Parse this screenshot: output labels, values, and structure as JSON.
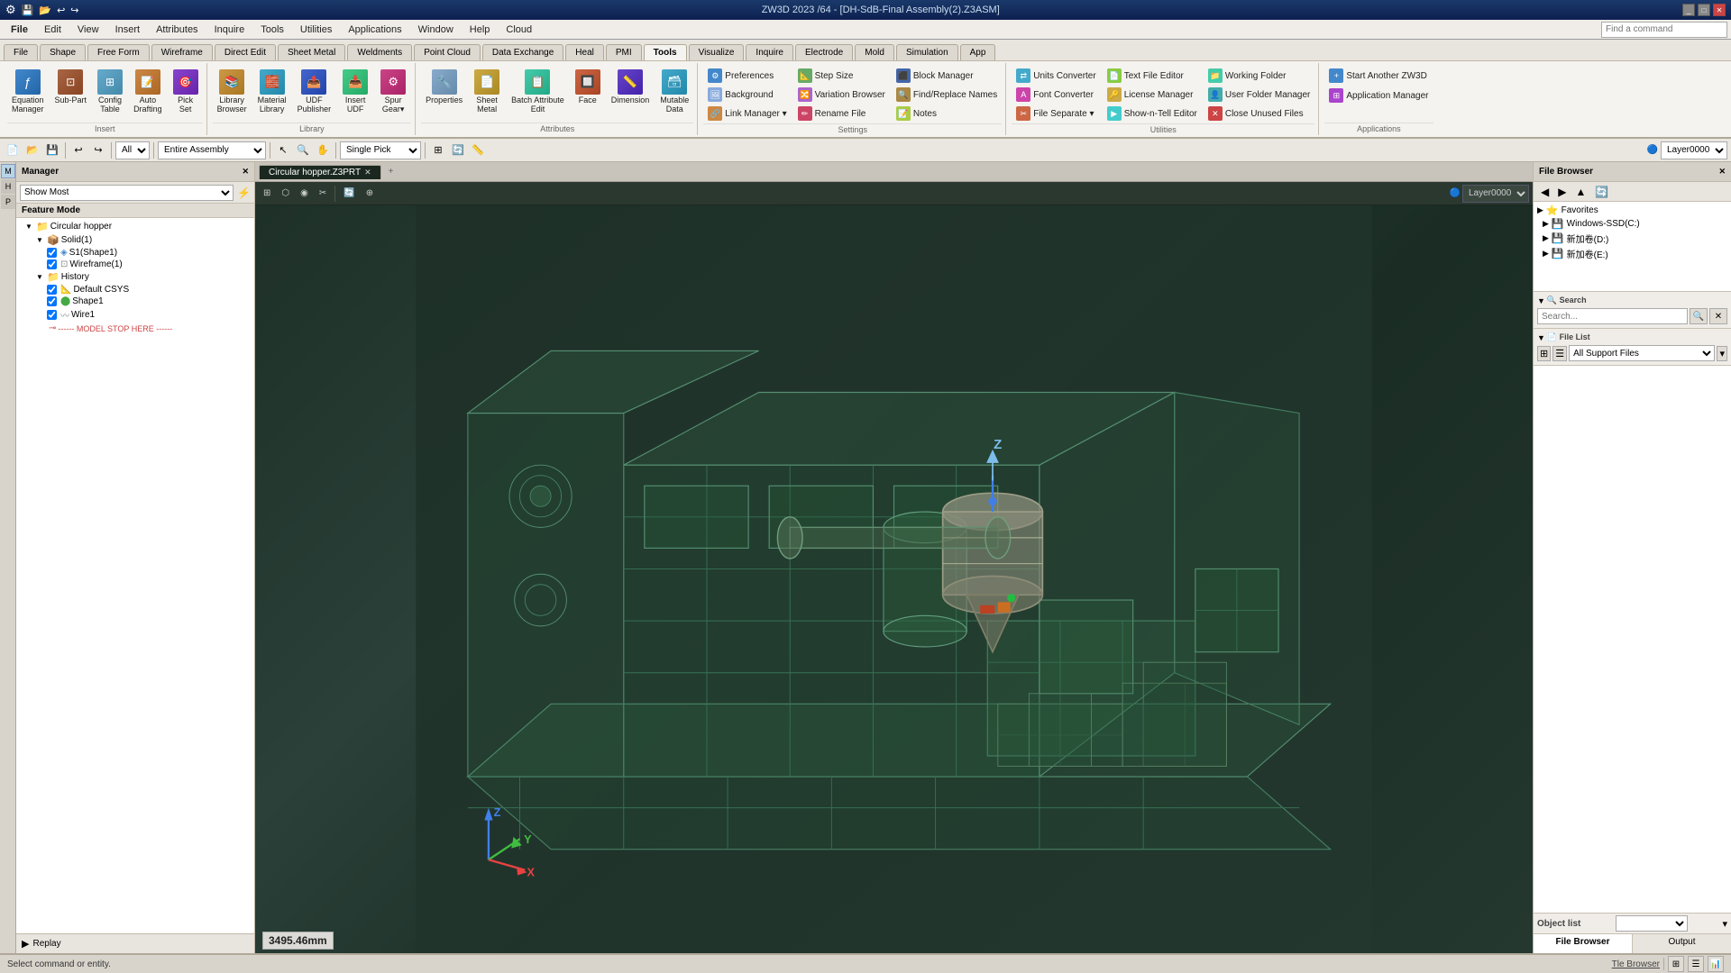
{
  "title_bar": {
    "title": "ZW3D 2023 /64 - [DH-SdB-Final Assembly(2).Z3ASM]",
    "app_icon": "⚙"
  },
  "menu_bar": {
    "items": [
      "File",
      "Edit",
      "View",
      "Insert",
      "Attributes",
      "Inquire",
      "Tools",
      "Utilities",
      "Applications",
      "Window",
      "Help",
      "Cloud"
    ]
  },
  "ribbon": {
    "tabs": [
      "File",
      "Shape",
      "Free Form",
      "Wireframe",
      "Direct Edit",
      "Sheet Metal",
      "Weldments",
      "Point Cloud",
      "Data Exchange",
      "Heal",
      "PMI",
      "Tools",
      "Visualize",
      "Inquire",
      "Electrode",
      "Mold",
      "Simulation",
      "App"
    ],
    "active_tab": "Tools",
    "groups": {
      "equation": {
        "label": "Equation\nManager",
        "group_name": "Insert"
      },
      "sub_part": {
        "label": "Sub-Part",
        "group_name": "Insert"
      },
      "config_table": {
        "label": "Config\nTable",
        "group_name": "Insert"
      },
      "auto_drafting": {
        "label": "Auto\nDrafting",
        "group_name": "Insert"
      },
      "pick_set": {
        "label": "Pick\nSet",
        "group_name": "Insert"
      },
      "library_browser": {
        "label": "Library\nBrowser",
        "group_name": "Library"
      },
      "material_library": {
        "label": "Material\nLibrary",
        "group_name": "Library"
      },
      "udf_publisher": {
        "label": "UDF\nPublisher",
        "group_name": "Library"
      },
      "insert_udf": {
        "label": "Insert\nUDF",
        "group_name": "Library"
      },
      "spur_gear": {
        "label": "Spur\nGear",
        "group_name": "Library"
      },
      "properties": {
        "label": "Properties",
        "group_name": "Attributes"
      },
      "sheet_metal": {
        "label": "Sheet\nMetal",
        "group_name": "Attributes"
      },
      "batch_attribute": {
        "label": "Batch Attribute\nEdit",
        "group_name": "Attributes"
      },
      "face": {
        "label": "Face",
        "group_name": "Attributes"
      },
      "dimension": {
        "label": "Dimension",
        "group_name": "Attributes"
      },
      "mutable_data": {
        "label": "Mutable\nData",
        "group_name": "Attributes"
      },
      "preferences": {
        "label": "Preferences",
        "group_name": "Settings"
      },
      "background": {
        "label": "Background",
        "group_name": "Settings"
      },
      "link_manager": {
        "label": "Link Manager ▾",
        "group_name": "Settings"
      },
      "step_size": {
        "label": "Step Size",
        "group_name": "Settings"
      },
      "variation_browser": {
        "label": "Variation Browser",
        "group_name": "Settings"
      },
      "rename_file": {
        "label": "Rename File",
        "group_name": "Settings"
      },
      "block_manager": {
        "label": "Block Manager",
        "group_name": "Settings"
      },
      "find_replace": {
        "label": "Find/Replace Names",
        "group_name": "Settings"
      },
      "units_converter": {
        "label": "Units Converter",
        "group_name": "Utilities"
      },
      "text_file_editor": {
        "label": "Text File Editor",
        "group_name": "Utilities"
      },
      "working_folder": {
        "label": "Working Folder",
        "group_name": "Utilities"
      },
      "start_another": {
        "label": "Start Another ZW3D",
        "group_name": "Applications"
      },
      "font_converter": {
        "label": "Font Converter",
        "group_name": "Utilities"
      },
      "license_manager": {
        "label": "License Manager",
        "group_name": "Utilities"
      },
      "file_separate": {
        "label": "File Separate ▾",
        "group_name": "Utilities"
      },
      "show_n_tell": {
        "label": "Show-n-Tell Editor",
        "group_name": "Utilities"
      },
      "user_folder": {
        "label": "User Folder Manager",
        "group_name": "Utilities"
      },
      "close_unused": {
        "label": "Close Unused Files",
        "group_name": "Utilities"
      },
      "application_manager": {
        "label": "Application Manager",
        "group_name": "Applications"
      },
      "notes": {
        "label": "Notes",
        "group_name": "Settings"
      }
    }
  },
  "toolbar": {
    "filter_label": "All",
    "scope_label": "Entire Assembly",
    "pick_mode": "Single Pick",
    "layer": "Layer0000"
  },
  "left_panel": {
    "title": "Manager",
    "filter_label": "Show Most",
    "feature_mode_label": "Feature Mode",
    "tree": [
      {
        "level": 0,
        "icon": "📁",
        "label": "Circular hopper",
        "expanded": true
      },
      {
        "level": 1,
        "icon": "📦",
        "label": "Solid(1)",
        "expanded": true
      },
      {
        "level": 2,
        "icon": "🔷",
        "label": "S1(Shape1)",
        "checked": true
      },
      {
        "level": 2,
        "icon": "🔲",
        "label": "Wireframe(1)",
        "checked": true
      },
      {
        "level": 1,
        "icon": "📁",
        "label": "History",
        "expanded": true
      },
      {
        "level": 2,
        "icon": "📐",
        "label": "Default CSYS",
        "checked": true
      },
      {
        "level": 2,
        "icon": "🟢",
        "label": "Shape1",
        "checked": true
      },
      {
        "level": 2,
        "icon": "〰",
        "label": "Wire1",
        "checked": true
      },
      {
        "level": 2,
        "icon": "🔴",
        "label": "------ MODEL STOP HERE ------"
      }
    ],
    "replay_label": "Replay"
  },
  "viewport": {
    "tabs": [
      {
        "label": "Circular hopper.Z3PRT",
        "active": true
      },
      {
        "label": "×",
        "close": true
      }
    ],
    "measurement": "3495.46mm",
    "status_text": "Select command or entity."
  },
  "right_panel": {
    "title": "File Browser",
    "search": {
      "label": "Search",
      "placeholder": "Search...",
      "filter": "All Support Files"
    },
    "file_list_label": "File List",
    "favorites": {
      "label": "Favorites",
      "expanded": true
    },
    "drives": [
      {
        "label": "Windows-SSD(C:)",
        "icon": "💾"
      },
      {
        "label": "新加卷(D:)",
        "icon": "💾"
      },
      {
        "label": "新加卷(E:)",
        "icon": "💾"
      }
    ],
    "object_list_label": "Object list",
    "output_tabs": [
      "File Browser",
      "Output"
    ],
    "active_output_tab": "File Browser"
  },
  "bottom_status": {
    "status": "Select command or entity.",
    "tle_browser": "Tle Browser",
    "icons": [
      "grid",
      "table",
      "chart"
    ]
  },
  "coord_axis": {
    "x_label": "X",
    "y_label": "Y",
    "z_label": "Z",
    "main_z_label": "Z"
  }
}
